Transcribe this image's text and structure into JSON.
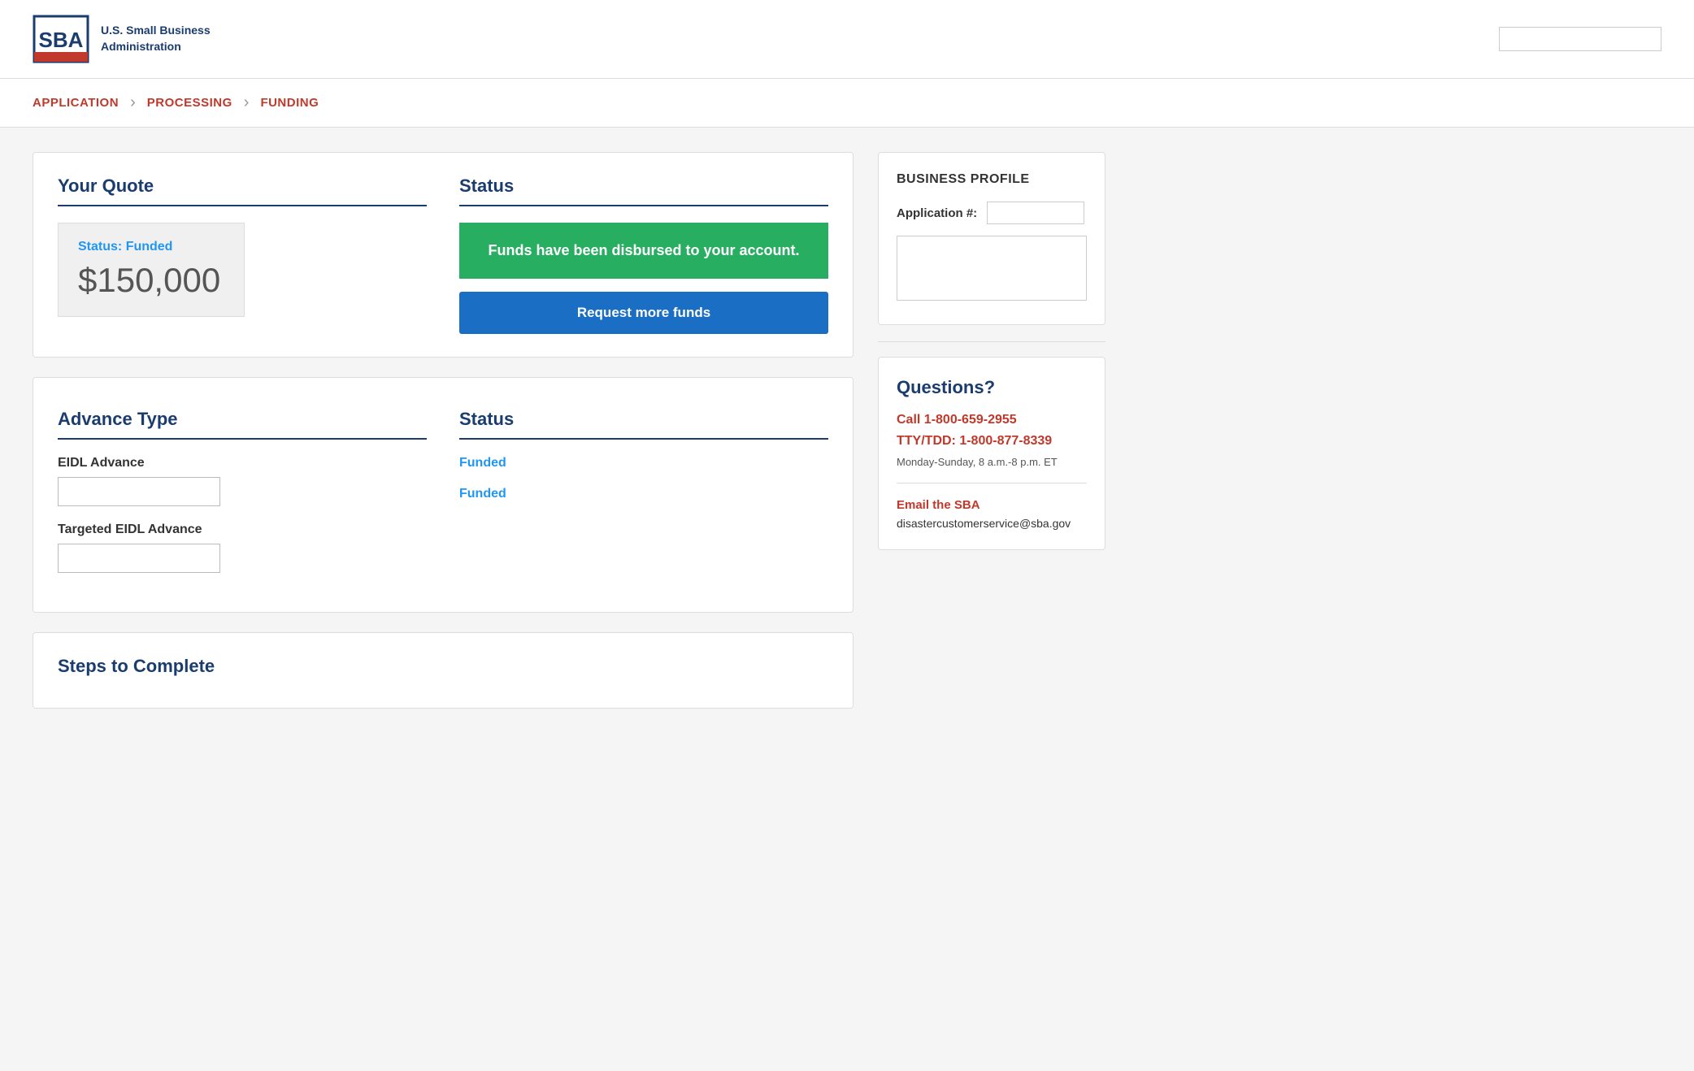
{
  "header": {
    "logo_text_line1": "U.S. Small Business",
    "logo_text_line2": "Administration"
  },
  "progress": {
    "steps": [
      {
        "label": "APPLICATION",
        "active": true
      },
      {
        "label": "PROCESSING",
        "active": true
      },
      {
        "label": "FUNDING",
        "active": true
      }
    ]
  },
  "quote": {
    "section_title": "Your Quote",
    "status_label": "Status:",
    "status_value": "Funded",
    "amount": "$150,000"
  },
  "status": {
    "section_title": "Status",
    "funded_message": "Funds have been disbursed to your account.",
    "request_button": "Request more funds"
  },
  "advance": {
    "section_title_left": "Advance Type",
    "section_title_right": "Status",
    "items": [
      {
        "label": "EIDL Advance",
        "status": "Funded"
      },
      {
        "label": "Targeted EIDL Advance",
        "status": "Funded"
      }
    ]
  },
  "steps": {
    "section_title": "Steps to Complete"
  },
  "sidebar": {
    "business_profile_title": "BUSINESS PROFILE",
    "app_number_label": "Application #:",
    "questions_title": "Questions?",
    "phone1": "Call 1-800-659-2955",
    "phone2": "TTY/TDD: 1-800-877-8339",
    "hours": "Monday-Sunday, 8 a.m.-8 p.m. ET",
    "email_label": "Email the SBA",
    "email_address": "disastercustomerservice@sba.gov"
  }
}
